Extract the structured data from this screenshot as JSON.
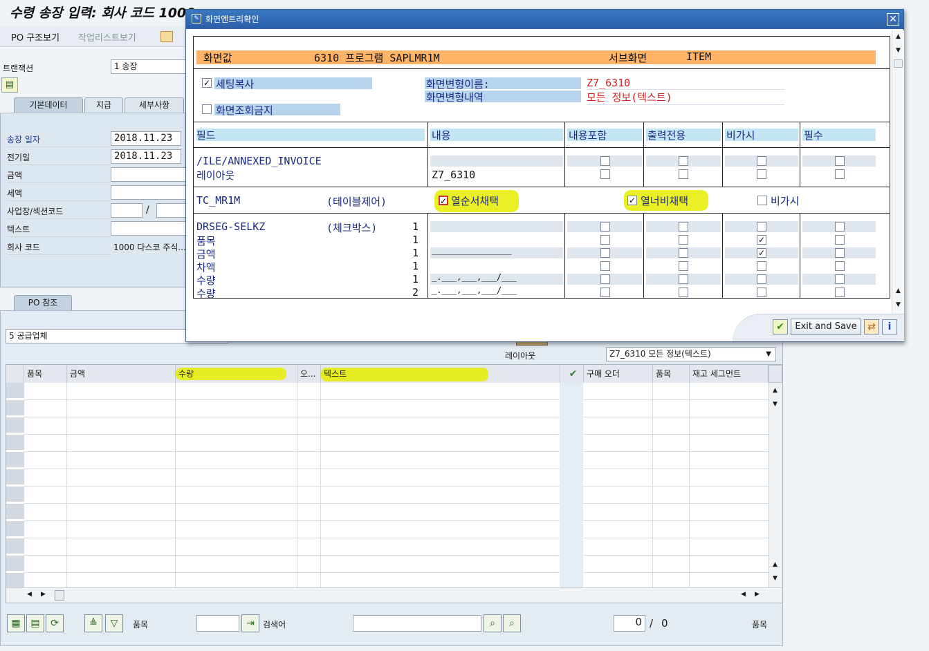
{
  "main": {
    "title": "수령 송장 입력: 회사 코드 1000",
    "toolbar": {
      "po_structure": "PO 구조보기",
      "worklist": "작업리스트보기"
    },
    "transaction_label": "트랜잭션",
    "transaction_value": "1 송장",
    "tabs": [
      "기본데이터",
      "지급",
      "세부사항"
    ],
    "fields": [
      {
        "label": "송장 일자",
        "value": "2018.11.23"
      },
      {
        "label": "전기일",
        "value": "2018.11.23"
      },
      {
        "label": "금액",
        "value": ""
      },
      {
        "label": "세액",
        "value": ""
      },
      {
        "label": "사업장/섹션코드",
        "value": ""
      },
      {
        "label": "텍스트",
        "value": ""
      },
      {
        "label": "회사 코드",
        "value": "1000 다스코 주식..."
      }
    ],
    "section_sep": "/",
    "po_tab": "PO 참조",
    "vendor_select": "5 공급업체",
    "layout_label": "레이아웃",
    "layout_value": "Z7_6310 모든 정보(텍스트)",
    "table_headers": [
      "품목",
      "금액",
      "수량",
      "오...",
      "텍스트",
      "",
      "구매 오더",
      "품목",
      "재고 세그먼트"
    ],
    "bottom": {
      "item_label": "품목",
      "search_label": "검색어",
      "count": "0",
      "sep": "/",
      "total": "0",
      "item_label2": "품목"
    }
  },
  "dialog": {
    "title": "화면엔트리확인",
    "screen_value_label": "화면값",
    "program": "6310 프로그램 SAPLMR1M",
    "subscreen_label": "서브화면",
    "subscreen_value": "ITEM",
    "copy_settings": "세팅복사",
    "no_display": "화면조회금지",
    "variant_name_label": "화면변형이름:",
    "variant_name_value": "Z7_6310",
    "variant_desc_label": "화면변형내역",
    "variant_desc_value": "모든 정보(텍스트)",
    "col_headers": [
      "필드",
      "내용",
      "내용포함",
      "출력전용",
      "비가시",
      "필수"
    ],
    "rows1": [
      "/ILE/ANNEXED_INVOICE",
      "레이아웃"
    ],
    "rows1_content": "Z7_6310",
    "tc_name": "TC_MR1M",
    "tc_type": "(테이블제어)",
    "tc_opt1": "열순서채택",
    "tc_opt2": "열너비채택",
    "tc_opt3": "비가시",
    "drseg": "DRSEG-SELKZ",
    "drseg_type": "(체크박스)",
    "rows2": [
      {
        "name": "DRSEG-SELKZ",
        "n": "1",
        "content": ""
      },
      {
        "name": "품목",
        "n": "1",
        "content": ""
      },
      {
        "name": "금액",
        "n": "1",
        "content": "________________"
      },
      {
        "name": "차액",
        "n": "1",
        "content": ""
      },
      {
        "name": "수량",
        "n": "1",
        "content": "_.___,___,___/___"
      },
      {
        "name": "수량",
        "n": "2",
        "content": "_.___,___,___/___"
      }
    ],
    "exit_save": "Exit and Save"
  },
  "colors": {
    "orange_bar": "#ffb366",
    "highlight": "#e8ed00",
    "dialog_title": "#2a5ea8"
  }
}
